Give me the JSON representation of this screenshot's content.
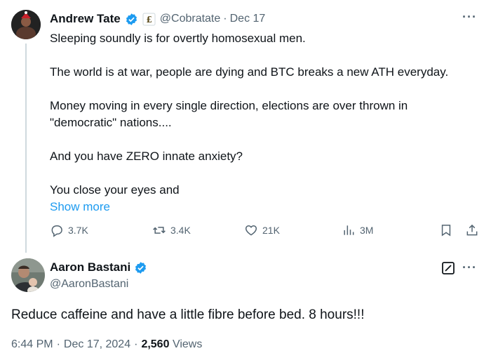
{
  "colors": {
    "accent": "#1d9bf0",
    "muted": "#536471",
    "text": "#0f1419",
    "thread_line": "#cfd9de"
  },
  "tweet1": {
    "author_name": "Andrew Tate",
    "handle": "@Cobratate",
    "separator": "·",
    "date": "Dec 17",
    "verified_icon": "verified-badge-icon",
    "affiliate_icon": "affiliate-badge-icon",
    "paragraphs": [
      "Sleeping soundly is for overtly homosexual men.",
      "The world is at war, people are dying and BTC breaks a new ATH everyday.",
      "Money moving in every single direction, elections are over thrown in\n\"democratic\" nations....",
      "And you have ZERO innate anxiety?",
      "You close your eyes and"
    ],
    "show_more": "Show more",
    "actions": {
      "replies": "3.7K",
      "reposts": "3.4K",
      "likes": "21K",
      "views": "3M"
    }
  },
  "tweet2": {
    "author_name": "Aaron Bastani",
    "handle": "@AaronBastani",
    "verified_icon": "verified-badge-icon",
    "text": "Reduce caffeine and have a little fibre before bed. 8 hours!!!",
    "time": "6:44 PM",
    "separator": "·",
    "date": "Dec 17, 2024",
    "views_count": "2,560",
    "views_label": "Views"
  },
  "more_glyph": "···"
}
